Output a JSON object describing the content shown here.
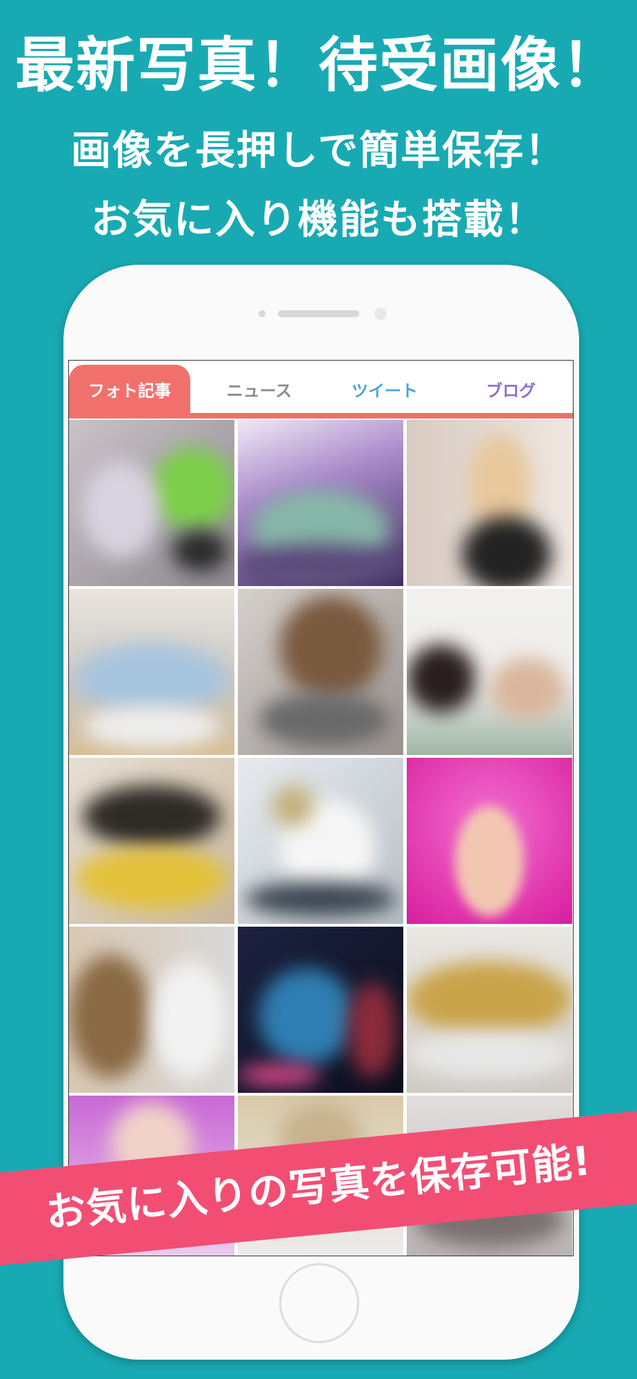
{
  "promo": {
    "headline": "最新写真！待受画像！",
    "subline_1": "画像を長押しで簡単保存！",
    "subline_2": "お気に入り機能も搭載！",
    "banner": "お気に入りの写真を保存可能!"
  },
  "tabs": [
    {
      "label": "フォト記事",
      "color": "#ffffff",
      "active": true
    },
    {
      "label": "ニュース",
      "color": "#8a8a8a",
      "active": false
    },
    {
      "label": "ツイート",
      "color": "#4aa3e0",
      "active": false
    },
    {
      "label": "ブログ",
      "color": "#8a6fd8",
      "active": false
    }
  ],
  "colors": {
    "background": "#18aab3",
    "tab_accent": "#f2706b",
    "banner": "#f24e74"
  },
  "photos": [
    "photo-1",
    "photo-2",
    "photo-3",
    "photo-4",
    "photo-5",
    "photo-6",
    "photo-7",
    "photo-8",
    "photo-9",
    "photo-10",
    "photo-11",
    "photo-12",
    "photo-13",
    "photo-14",
    "photo-15"
  ]
}
